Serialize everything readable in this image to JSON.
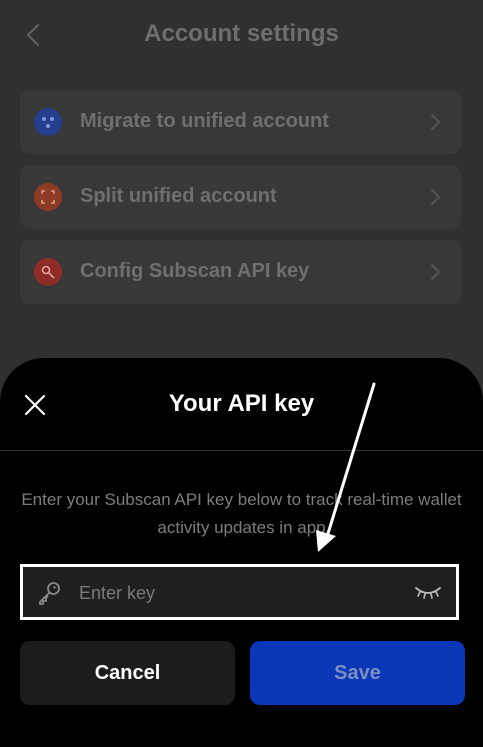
{
  "header": {
    "title": "Account settings"
  },
  "settings": {
    "items": [
      {
        "label": "Migrate to unified account",
        "icon": "migrate-icon",
        "color": "#2a4fb8"
      },
      {
        "label": "Split unified account",
        "icon": "split-icon",
        "color": "#b8452a"
      },
      {
        "label": "Config Subscan API key",
        "icon": "key-icon",
        "color": "#b8302a"
      }
    ]
  },
  "sheet": {
    "title": "Your API key",
    "description": "Enter your Subscan API key below to track real-time wallet activity updates in app",
    "input": {
      "placeholder": "Enter key",
      "value": ""
    },
    "cancel_label": "Cancel",
    "save_label": "Save"
  },
  "colors": {
    "accent": "#0a36b8",
    "highlight_border": "#ffffff"
  }
}
